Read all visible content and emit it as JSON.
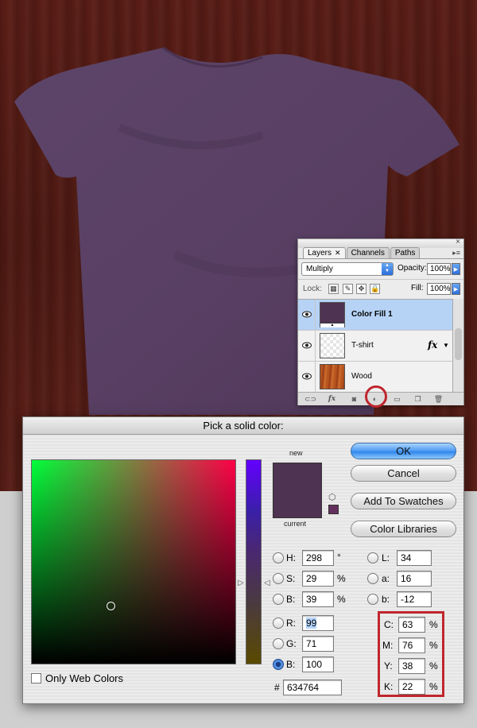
{
  "layers_panel": {
    "tabs": [
      "Layers",
      "Channels",
      "Paths"
    ],
    "close_glyph": "×",
    "menu_glyph": "▾≡",
    "blend_mode": "Multiply",
    "opacity_label": "Opacity:",
    "opacity_value": "100%",
    "lock_label": "Lock:",
    "fill_label": "Fill:",
    "fill_value": "100%",
    "layers": [
      {
        "name": "Color Fill 1",
        "thumb_color": "#4f3352",
        "selected": true
      },
      {
        "name": "T-shirt",
        "fx": "fx"
      },
      {
        "name": "Wood"
      }
    ],
    "footer_icons": [
      "link-icon",
      "fx-icon",
      "mask-icon",
      "adjustment-layer-icon",
      "group-folder-icon",
      "new-layer-icon",
      "trash-icon"
    ]
  },
  "picker": {
    "title": "Pick a solid color:",
    "new_label": "new",
    "current_label": "current",
    "new_color": "#4f3352",
    "current_color": "#4f3352",
    "buttons": {
      "ok": "OK",
      "cancel": "Cancel",
      "add_swatches": "Add To Swatches",
      "color_libraries": "Color Libraries"
    },
    "hsb": {
      "H": "298",
      "H_unit": "°",
      "S": "29",
      "S_unit": "%",
      "B": "39",
      "B_unit": "%"
    },
    "lab": {
      "L": "34",
      "a": "16",
      "b": "-12"
    },
    "rgb": {
      "R": "99",
      "G": "71",
      "B": "100"
    },
    "cmyk": {
      "C": "63",
      "M": "76",
      "Y": "38",
      "K": "22",
      "unit": "%"
    },
    "hex_label": "#",
    "hex": "634764",
    "labels": {
      "H": "H:",
      "S": "S:",
      "Bh": "B:",
      "R": "R:",
      "G": "G:",
      "Br": "B:",
      "L": "L:",
      "a": "a:",
      "b": "b:",
      "C": "C:",
      "M": "M:",
      "Y": "Y:",
      "K": "K:"
    },
    "only_web_colors": "Only Web Colors",
    "selected_radio": "B (blue)"
  },
  "colors": {
    "highlight": "#c0262d",
    "tshirt": "#5a4266",
    "wood": "#521b14"
  }
}
